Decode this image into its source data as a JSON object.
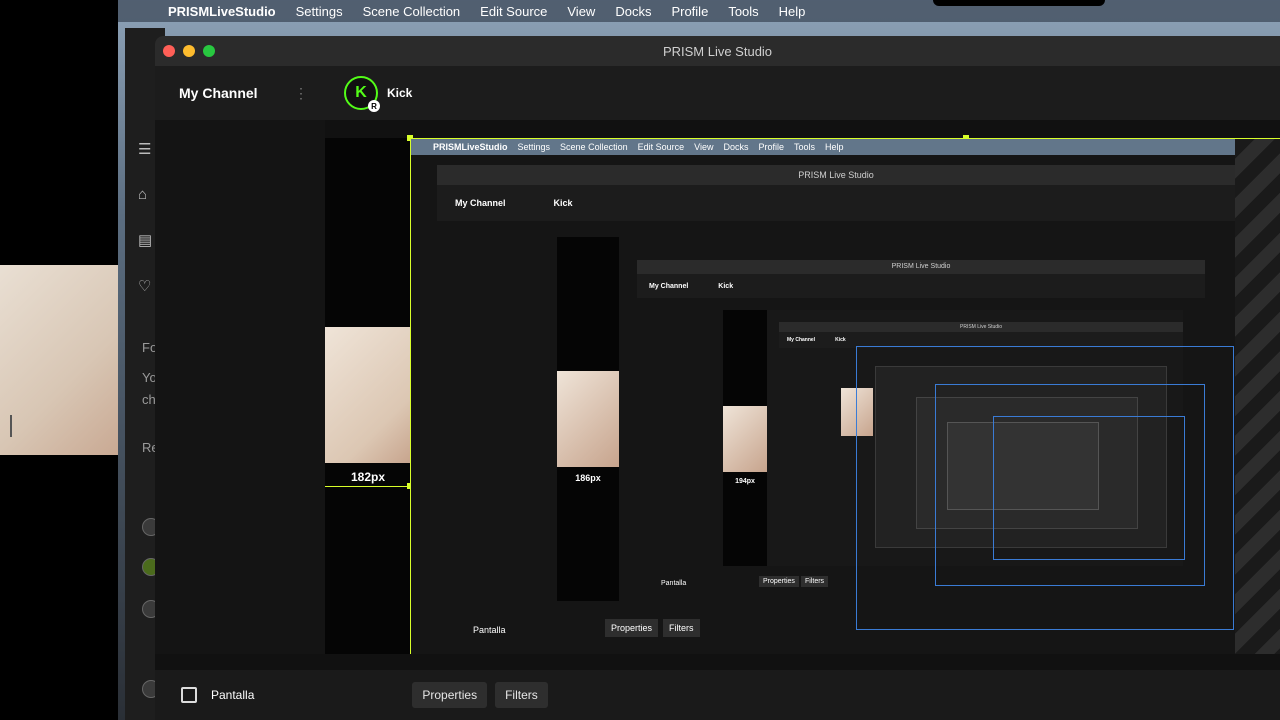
{
  "menubar": {
    "apple_icon": "apple-icon",
    "app_name": "PRISMLiveStudio",
    "items": [
      "Settings",
      "Scene Collection",
      "Edit Source",
      "View",
      "Docks",
      "Profile",
      "Tools",
      "Help"
    ]
  },
  "window": {
    "title": "PRISM Live Studio",
    "channel_name": "My Channel",
    "platform_label": "Kick",
    "platform_badge": "R",
    "platform_letter": "K"
  },
  "preview": {
    "size_labels": [
      "182px",
      "186px",
      "194px"
    ],
    "nested_titles": [
      "PRISM Live Studio",
      "PRISM Live Studio",
      "PRISM Live Studio"
    ],
    "nested_channel": [
      "My Channel",
      "My Channel",
      "My Channel"
    ],
    "nested_platform": [
      "Kick",
      "Kick",
      "Kick"
    ],
    "nested_scene": [
      "Pantalla",
      "Pantalla"
    ],
    "nested_properties": [
      "Properties",
      "Properties"
    ],
    "nested_filters": [
      "Filters",
      "Filters"
    ]
  },
  "sidebar": {
    "texts": [
      "Fo",
      "Yo",
      "ch",
      "Re"
    ]
  },
  "bottom": {
    "scene_label": "Pantalla",
    "properties_label": "Properties",
    "filters_label": "Filters"
  },
  "colors": {
    "guide": "#d8ff2a",
    "kick_green": "#53fc18",
    "selection_blue": "#3a7bd5"
  }
}
